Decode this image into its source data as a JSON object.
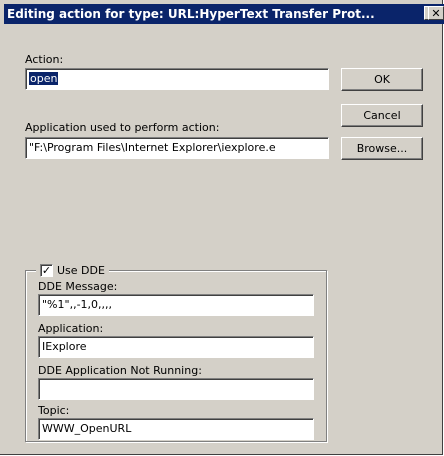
{
  "window": {
    "title": "Editing action for type: URL:HyperText Transfer Prot...",
    "help_glyph": "?",
    "close_glyph": "✕"
  },
  "action": {
    "label": "Action:",
    "value": "open"
  },
  "application": {
    "label": "Application used to perform action:",
    "value": "\"F:\\Program Files\\Internet Explorer\\iexplore.e"
  },
  "buttons": {
    "ok": "OK",
    "cancel": "Cancel",
    "browse": "Browse..."
  },
  "dde": {
    "checkbox_label": "Use DDE",
    "checked": true,
    "check_glyph": "✓",
    "message_label": "DDE Message:",
    "message_value": "\"%1\",,-1,0,,,,",
    "application_label": "Application:",
    "application_value": "IExplore",
    "not_running_label": "DDE Application Not Running:",
    "not_running_value": "",
    "topic_label": "Topic:",
    "topic_value": "WWW_OpenURL"
  }
}
